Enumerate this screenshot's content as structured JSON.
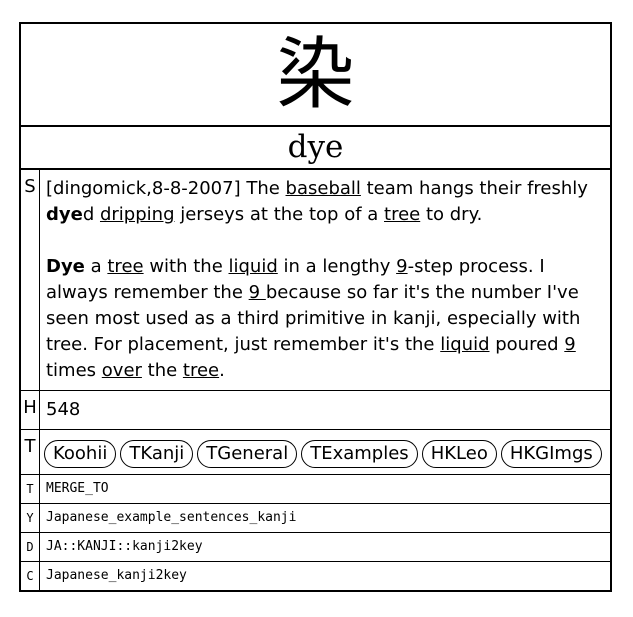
{
  "card": {
    "kanji": "染",
    "keyword": "dye",
    "story": {
      "label": "S",
      "p1": {
        "t1": "[dingomick,8-8-2007] The ",
        "u1": "baseball",
        "t2": " team hangs their freshly ",
        "b1": "dye",
        "t3": "d ",
        "u2": "dripping",
        "t4": " jerseys at the top of a ",
        "u3": "tree",
        "t5": " to dry."
      },
      "p2": {
        "b1": "Dye",
        "t1": " a ",
        "u1": "tree",
        "t2": " with the ",
        "u2": "liquid",
        "t3": " in a lengthy ",
        "u3": "9",
        "t4": "-step process. I always remember the ",
        "u4": "9 ",
        "t5": "because so far it's the number I've seen most used as a third primitive in kanji, especially with tree. For placement, just remember it's the ",
        "u5": "liquid",
        "t6": " poured ",
        "u6": "9",
        "t7": " times ",
        "u7": "over",
        "t8": " the ",
        "u8": "tree",
        "t9": "."
      }
    },
    "heisig": {
      "label": "H",
      "value": "548"
    },
    "links": {
      "label": "T",
      "items": [
        "Koohii",
        "TKanji",
        "TGeneral",
        "TExamples",
        "HKLeo",
        "HKGImgs"
      ]
    },
    "meta": [
      {
        "label": "T",
        "value": "MERGE_TO"
      },
      {
        "label": "Y",
        "value": "Japanese_example_sentences_kanji"
      },
      {
        "label": "D",
        "value": "JA::KANJI::kanji2key"
      },
      {
        "label": "C",
        "value": "Japanese_kanji2key"
      }
    ]
  }
}
